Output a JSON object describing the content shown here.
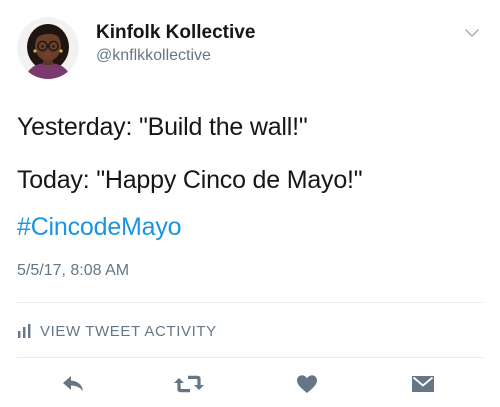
{
  "author": {
    "display_name": "Kinfolk Kollective",
    "handle": "@knflkkollective"
  },
  "tweet": {
    "line1": "Yesterday: \"Build the wall!\"",
    "line2": "Today: \"Happy Cinco de Mayo!\"",
    "hashtag": "#CincodeMayo",
    "timestamp": "5/5/17, 8:08 AM"
  },
  "activity": {
    "label": "VIEW TWEET ACTIVITY",
    "icon": "bar-chart-icon"
  },
  "actions": [
    {
      "name": "reply",
      "icon": "reply-icon"
    },
    {
      "name": "retweet",
      "icon": "retweet-icon"
    },
    {
      "name": "like",
      "icon": "heart-icon"
    },
    {
      "name": "direct-message",
      "icon": "envelope-icon"
    }
  ],
  "colors": {
    "text": "#14171a",
    "secondary": "#657786",
    "link": "#1b95e0",
    "icon": "#657786",
    "divider": "#e6ecf0"
  }
}
